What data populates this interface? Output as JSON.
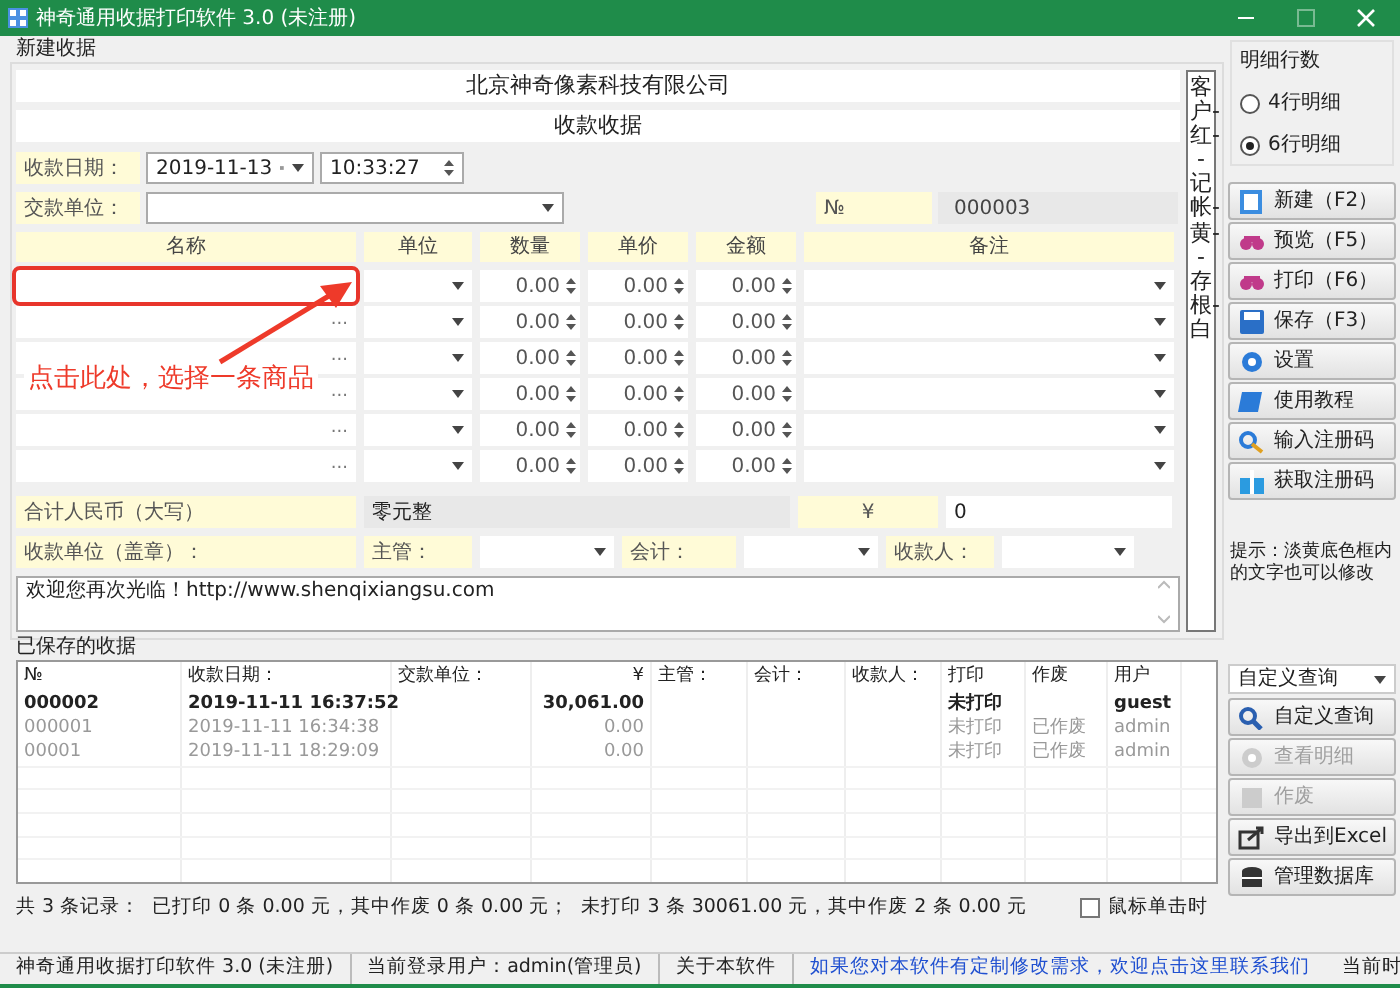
{
  "window": {
    "title": "神奇通用收据打印软件 3.0 (未注册)"
  },
  "receipt": {
    "group_label": "新建收据",
    "company": "北京神奇像素科技有限公司",
    "doc_title": "收款收据",
    "date_label": "收款日期：",
    "date": "2019-11-13",
    "time": "10:33:27",
    "payer_label": "交款单位：",
    "no_label": "№",
    "no_value": "000003",
    "columns": [
      "名称",
      "单位",
      "数量",
      "单价",
      "金额",
      "备注"
    ],
    "rows": [
      {
        "highlighted": true,
        "quantity": "0.00",
        "price": "0.00",
        "amount": "0.00"
      },
      {
        "highlighted": false,
        "quantity": "0.00",
        "price": "0.00",
        "amount": "0.00"
      },
      {
        "highlighted": false,
        "quantity": "0.00",
        "price": "0.00",
        "amount": "0.00"
      },
      {
        "highlighted": false,
        "quantity": "0.00",
        "price": "0.00",
        "amount": "0.00"
      },
      {
        "highlighted": false,
        "quantity": "0.00",
        "price": "0.00",
        "amount": "0.00"
      },
      {
        "highlighted": false,
        "quantity": "0.00",
        "price": "0.00",
        "amount": "0.00"
      }
    ],
    "browse_mark": "...",
    "total_label": "合计人民币（大写）",
    "total_words": "零元整",
    "currency": "¥",
    "total_value": "0",
    "unit_label": "收款单位（盖章）：",
    "manager_label": "主管：",
    "accountant_label": "会计：",
    "cashier_label": "收款人：",
    "note": "欢迎您再次光临！http://www.shenqixiangsu.com",
    "copies": "客户-红--记帐-黄--存根-白"
  },
  "annotation": {
    "text": "点击此处，选择一条商品"
  },
  "detail_lines": {
    "label": "明细行数",
    "options": [
      {
        "label": "4行明细",
        "selected": false
      },
      {
        "label": "6行明细",
        "selected": true
      }
    ]
  },
  "actions": [
    {
      "label": "新建（F2）"
    },
    {
      "label": "预览（F5）"
    },
    {
      "label": "打印（F6）"
    },
    {
      "label": "保存（F3）"
    },
    {
      "label": "设置"
    },
    {
      "label": "使用教程"
    },
    {
      "label": "输入注册码"
    },
    {
      "label": "获取注册码"
    }
  ],
  "tip": "提示：淡黄底色框内的文字也可以修改",
  "saved": {
    "label": "已保存的收据",
    "columns": [
      "№",
      "收款日期：",
      "交款单位：",
      "¥",
      "主管：",
      "会计：",
      "收款人：",
      "打印",
      "作废",
      "用户"
    ],
    "rows": [
      {
        "voided": false,
        "cells": [
          "000002",
          "2019-11-11 16:37:52",
          "",
          "30,061.00",
          "",
          "",
          "",
          "未打印",
          "",
          "guest"
        ]
      },
      {
        "voided": true,
        "cells": [
          "000001",
          "2019-11-11 16:34:38",
          "",
          "0.00",
          "",
          "",
          "",
          "未打印",
          "已作废",
          "admin"
        ]
      },
      {
        "voided": true,
        "cells": [
          "00001",
          "2019-11-11 18:29:09",
          "",
          "0.00",
          "",
          "",
          "",
          "未打印",
          "已作废",
          "admin"
        ]
      }
    ]
  },
  "query": {
    "select": "自定义查询",
    "buttons": [
      {
        "label": "自定义查询",
        "disabled": false
      },
      {
        "label": "查看明细",
        "disabled": true
      },
      {
        "label": "作废",
        "disabled": true
      },
      {
        "label": "导出到Excel",
        "disabled": false
      },
      {
        "label": "管理数据库",
        "disabled": false
      }
    ]
  },
  "summary": "共 3 条记录：  已打印 0 条 0.00 元，其中作废 0 条 0.00 元；  未打印 3 条 30061.00 元，其中作废 2 条 0.00 元",
  "click_option": {
    "label": "鼠标单击时",
    "checked": false
  },
  "status_bar": [
    {
      "kind": "text",
      "text": "神奇通用收据打印软件 3.0 (未注册)"
    },
    {
      "kind": "text",
      "text": "当前登录用户：admin(管理员)"
    },
    {
      "kind": "text",
      "text": "关于本软件"
    },
    {
      "kind": "link",
      "text": "如果您对本软件有定制修改需求，欢迎点击这里联系我们"
    },
    {
      "kind": "text",
      "text": "当前时"
    }
  ]
}
